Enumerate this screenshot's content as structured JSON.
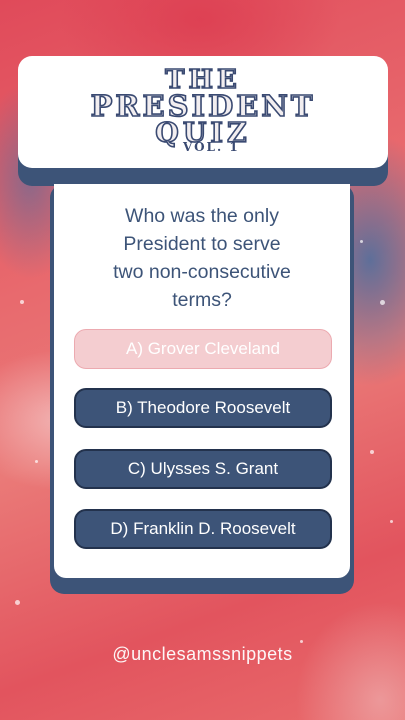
{
  "title": {
    "line1": "THE",
    "line2": "PRESIDENT",
    "line3": "QUIZ",
    "volume": "VOL. 1"
  },
  "question": {
    "lines": [
      "Who was the only",
      "President to serve",
      "two non-consecutive",
      "terms?"
    ]
  },
  "options": [
    {
      "label": "A) Grover Cleveland",
      "state": "correct"
    },
    {
      "label": "B) Theodore Roosevelt",
      "state": "normal"
    },
    {
      "label": "C) Ulysses S. Grant",
      "state": "normal"
    },
    {
      "label": "D) Franklin D. Roosevelt",
      "state": "normal"
    }
  ],
  "footer": {
    "handle": "@unclesamssnippets"
  },
  "colors": {
    "accent": "#3d5478",
    "correct_bg": "#f4cdd0",
    "background": "#e0555f"
  }
}
